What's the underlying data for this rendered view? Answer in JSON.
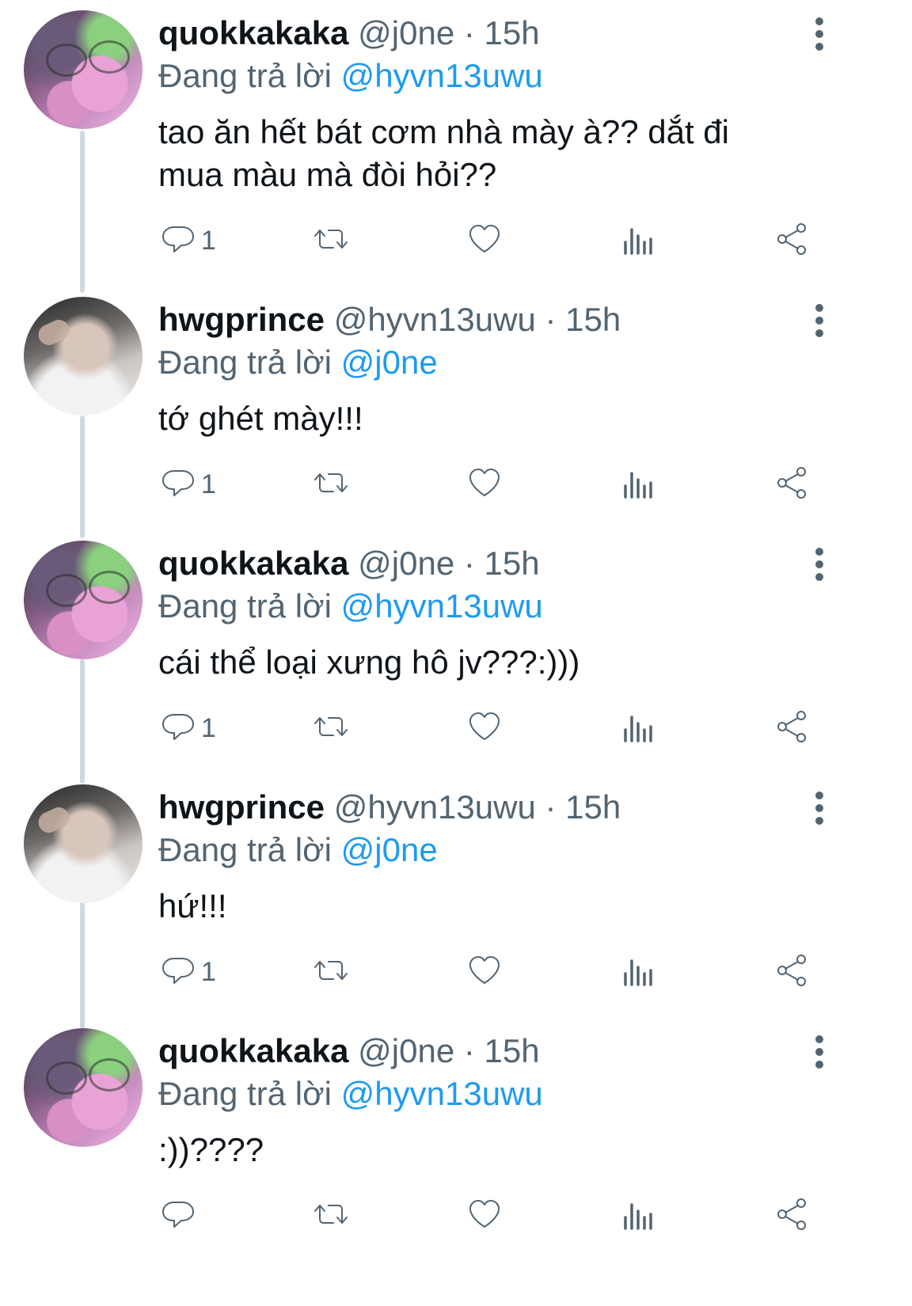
{
  "colors": {
    "accent": "#1d9bf0",
    "secondary_text": "#536471",
    "thread_line": "#cfd9de"
  },
  "tweets": [
    {
      "avatar": "quokka",
      "name": "quokkakaka",
      "handle": "@j0ne",
      "dot": "·",
      "time": "15h",
      "reply_prefix": "Đang trả lời",
      "reply_to": "@hyvn13uwu",
      "text": "tao ăn hết bát cơm nhà mày à?? dắt đi mua màu mà đòi hỏi??",
      "reply_count": "1"
    },
    {
      "avatar": "hwg",
      "name": "hwgprince",
      "handle": "@hyvn13uwu",
      "dot": "·",
      "time": "15h",
      "reply_prefix": "Đang trả lời",
      "reply_to": "@j0ne",
      "text": "tớ ghét mày!!!",
      "reply_count": "1"
    },
    {
      "avatar": "quokka",
      "name": "quokkakaka",
      "handle": "@j0ne",
      "dot": "·",
      "time": "15h",
      "reply_prefix": "Đang trả lời",
      "reply_to": "@hyvn13uwu",
      "text": "cái thể loại xưng hô jv???:)))",
      "reply_count": "1"
    },
    {
      "avatar": "hwg",
      "name": "hwgprince",
      "handle": "@hyvn13uwu",
      "dot": "·",
      "time": "15h",
      "reply_prefix": "Đang trả lời",
      "reply_to": "@j0ne",
      "text": "hứ!!!",
      "reply_count": "1"
    },
    {
      "avatar": "quokka",
      "name": "quokkakaka",
      "handle": "@j0ne",
      "dot": "·",
      "time": "15h",
      "reply_prefix": "Đang trả lời",
      "reply_to": "@hyvn13uwu",
      "text": ":))????",
      "reply_count": ""
    }
  ],
  "icons": {
    "reply": "reply-icon",
    "retweet": "retweet-icon",
    "like": "heart-icon",
    "views": "views-icon",
    "share": "share-icon",
    "more": "more-vertical-icon"
  }
}
